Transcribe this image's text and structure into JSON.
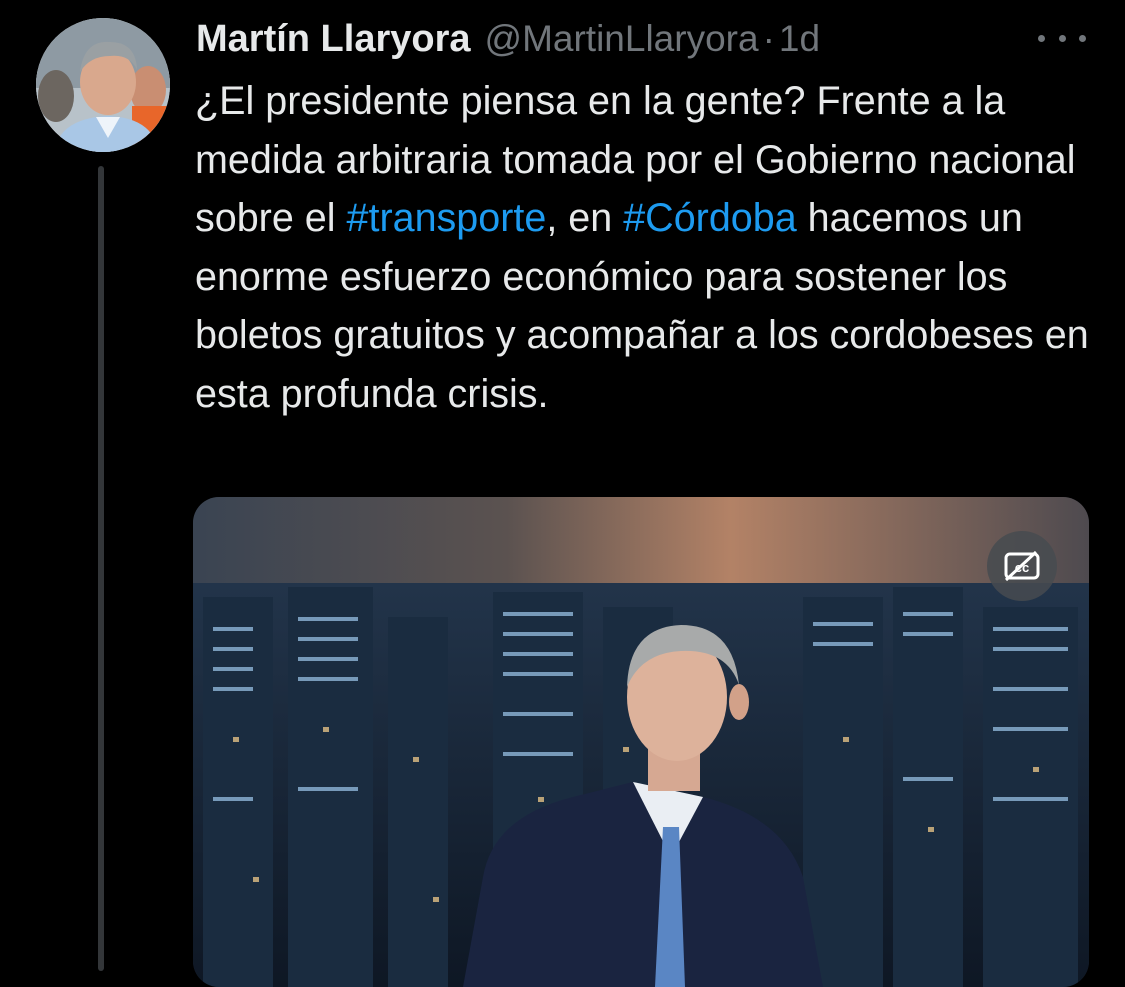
{
  "author": {
    "display_name": "Martín Llaryora",
    "handle": "@MartinLlaryora",
    "separator": "·",
    "time": "1d",
    "avatar_icon": "profile-photo"
  },
  "tweet": {
    "text_segments": [
      {
        "type": "text",
        "value": "¿El presidente piensa en la gente? Frente a la medida arbitraria tomada por el Gobierno nacional sobre el "
      },
      {
        "type": "hashtag",
        "value": "#transporte"
      },
      {
        "type": "text",
        "value": ", en "
      },
      {
        "type": "hashtag",
        "value": "#Córdoba"
      },
      {
        "type": "text",
        "value": " hacemos un enorme esfuerzo económico para sostener los boletos gratuitos y acompañar a los cordobeses en esta profunda crisis."
      }
    ]
  },
  "media": {
    "kind": "video",
    "captions_icon": "captions-off-icon"
  },
  "icons": {
    "more": "more-horizontal-icon"
  },
  "colors": {
    "background": "#000000",
    "text": "#e7e9ea",
    "secondary": "#71767b",
    "hashtag": "#1d9bf0",
    "thread_line": "#333639"
  }
}
